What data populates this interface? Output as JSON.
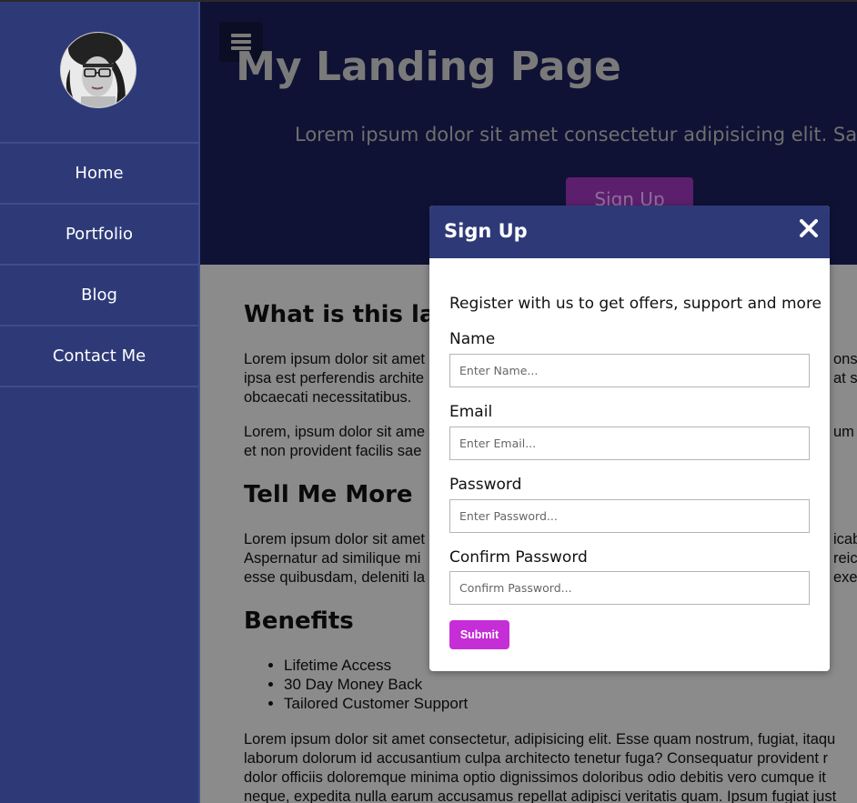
{
  "sidebar": {
    "nav": [
      {
        "label": "Home"
      },
      {
        "label": "Portfolio"
      },
      {
        "label": "Blog"
      },
      {
        "label": "Contact Me"
      }
    ]
  },
  "hero": {
    "title": "My Landing Page",
    "subtitle": "Lorem ipsum dolor sit amet consectetur adipisicing elit. Sapien",
    "cta": "Sign Up"
  },
  "content": {
    "heading1": "What is this landi",
    "p1": [
      "Lorem ipsum dolor sit amet",
      "ipsa est perferendis archite",
      "obcaecati necessitatibus."
    ],
    "p1_right": [
      "onse",
      "at sa"
    ],
    "p2": [
      "Lorem, ipsum dolor sit ame",
      "et non provident facilis sae"
    ],
    "p2_right": [
      "um c"
    ],
    "heading2": "Tell Me More",
    "p3": [
      "Lorem ipsum dolor sit amet",
      "Aspernatur ad similique mi",
      "esse quibusdam, deleniti la"
    ],
    "p3_right": [
      "icab",
      "reici",
      "exer"
    ],
    "heading3": "Benefits",
    "benefits": [
      "Lifetime Access",
      "30 Day Money Back",
      "Tailored Customer Support"
    ],
    "p4": [
      "Lorem ipsum dolor sit amet consectetur, adipisicing elit. Esse quam nostrum, fugiat, itaqu",
      "laborum dolorum id accusantium culpa architecto tenetur fuga? Consequatur provident r",
      "dolor officiis doloremque minima optio dignissimos doloribus odio debitis vero cumque it",
      "neque, expedita nulla earum accusamus repellat adipisci veritatis quam. Ipsum fugiat just"
    ]
  },
  "modal": {
    "title": "Sign Up",
    "intro": "Register with us to get offers, support and more",
    "fields": [
      {
        "label": "Name",
        "placeholder": "Enter Name..."
      },
      {
        "label": "Email",
        "placeholder": "Enter Email..."
      },
      {
        "label": "Password",
        "placeholder": "Enter Password..."
      },
      {
        "label": "Confirm Password",
        "placeholder": "Confirm Password..."
      }
    ],
    "submit": "Submit"
  },
  "colors": {
    "sidebar": "#2e3a78",
    "modal_header": "#2e3a78",
    "submit": "#c52ed6",
    "hero_bg": "#0f1234",
    "content_bg_dimmed": "#8b8b8b"
  },
  "icons": {
    "menu": "hamburger-icon",
    "close": "close-icon",
    "avatar": "avatar"
  }
}
